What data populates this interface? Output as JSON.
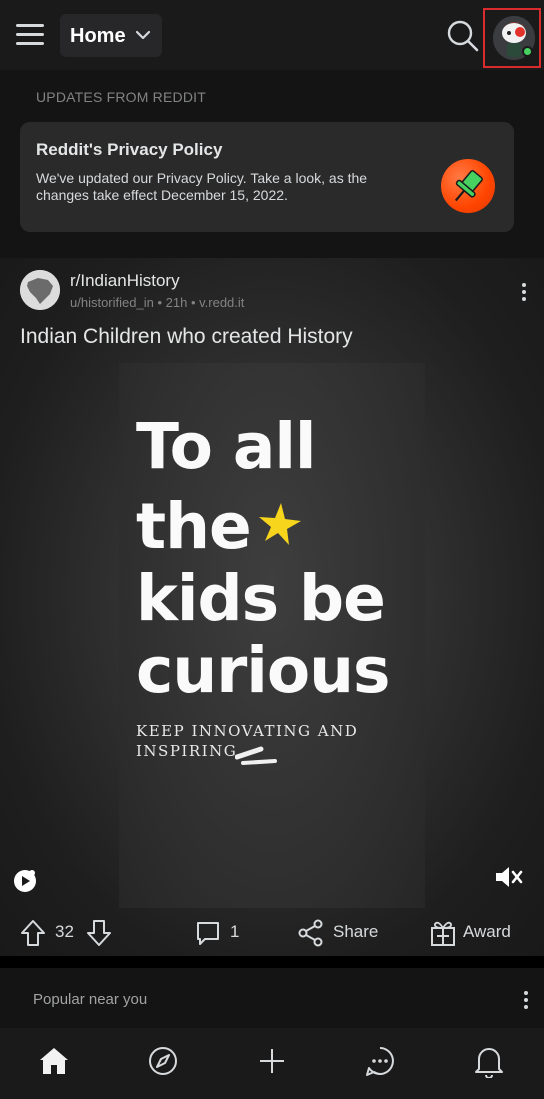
{
  "header": {
    "feed_label": "Home",
    "icons": [
      "menu-icon",
      "chevron-down-icon",
      "search-icon",
      "avatar"
    ]
  },
  "updates": {
    "section_title": "UPDATES FROM REDDIT",
    "card_title": "Reddit's Privacy Policy",
    "card_text": "We've updated our Privacy Policy. Take a look, as the changes take effect December 15, 2022.",
    "card_icon": "pushpin-icon"
  },
  "post": {
    "subreddit": "r/IndianHistory",
    "author": "u/historified_in",
    "age": "21h",
    "domain": "v.redd.it",
    "title": "Indian Children who created History",
    "media": {
      "lines": [
        "To all",
        "the",
        "kids be",
        "curious"
      ],
      "tagline_1": "KEEP INNOVATING AND",
      "tagline_2": "INSPIRING"
    },
    "votes": "32",
    "comments": "1",
    "share_label": "Share",
    "award_label": "Award"
  },
  "popular": {
    "label": "Popular near you"
  },
  "bottom_nav": [
    "home-icon",
    "compass-icon",
    "plus-icon",
    "chat-icon",
    "bell-icon"
  ],
  "colors": {
    "accent": "#ff4500",
    "online": "#46d160",
    "highlight_box": "#d92d2d",
    "star": "#f7d51d"
  }
}
